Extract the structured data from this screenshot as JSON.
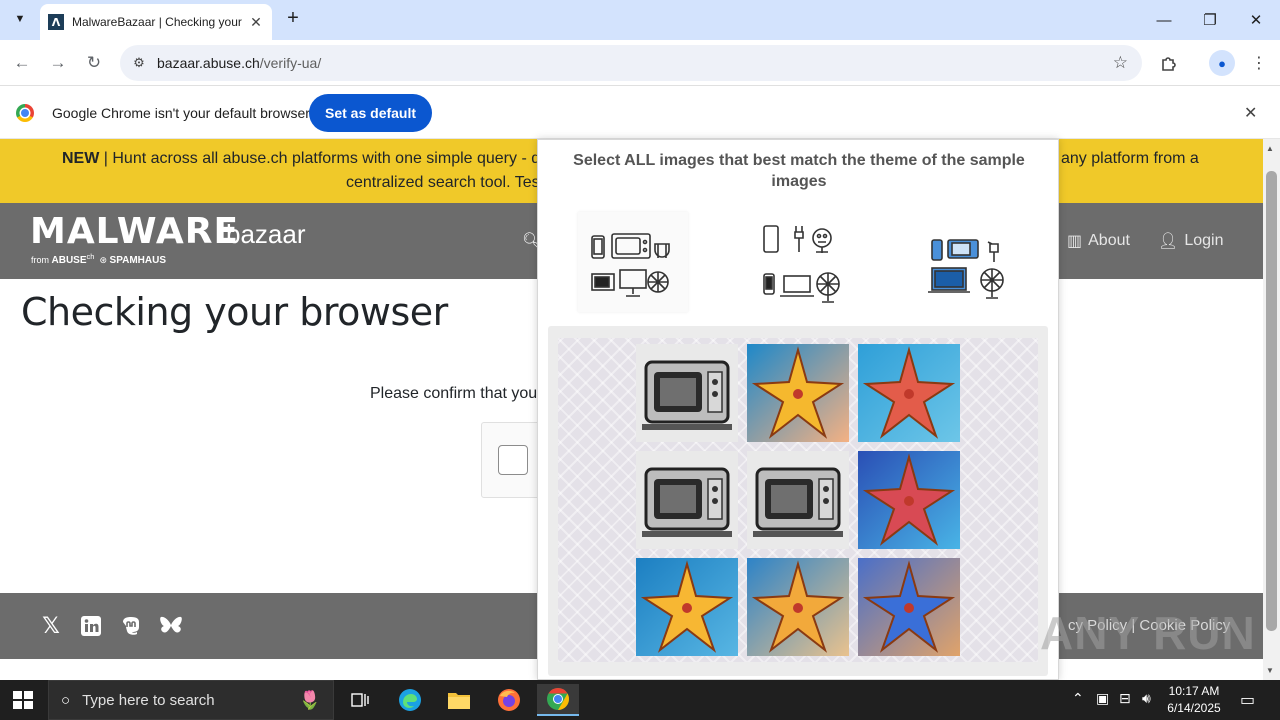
{
  "browser": {
    "tab_title": "MalwareBazaar | Checking your",
    "url_host": "bazaar.abuse.ch",
    "url_path": "/verify-ua/",
    "new_tab_label": "+",
    "infobar_text": "Google Chrome isn't your default browser",
    "infobar_button": "Set as default"
  },
  "announcement": {
    "lead": "NEW",
    "line1": " | Hunt across all abuse.ch platforms with one simple query - d",
    "line1_right": "any platform from a",
    "line2": "centralized search tool. Test"
  },
  "site_nav": {
    "logo_main": "MALWARE",
    "logo_sub": "bazaar",
    "logo_from": "from",
    "logo_abuse": "ABUSE",
    "logo_ch": "ch",
    "logo_spamhaus": "SPAMHAUS",
    "about": "About",
    "login": "Login"
  },
  "page": {
    "title": "Checking your browser",
    "confirm_text": "Please confirm that you"
  },
  "footer": {
    "links_text": "cy Policy  |  Cookie Policy"
  },
  "captcha": {
    "prompt": "Select ALL images that best match the theme of the sample images",
    "grid": [
      [
        "microwave",
        "starfish",
        "starfish"
      ],
      [
        "microwave",
        "microwave",
        "starfish"
      ],
      [
        "starfish",
        "starfish",
        "starfish"
      ]
    ]
  },
  "watermark": "ANY RUN",
  "taskbar": {
    "search_placeholder": "Type here to search",
    "time": "10:17 AM",
    "date": "6/14/2025"
  },
  "colors": {
    "announce_bg": "#f0c929",
    "nav_bg": "#6c6c6c",
    "chrome_accent": "#0b57d0",
    "tabstrip_bg": "#d3e3fd"
  }
}
